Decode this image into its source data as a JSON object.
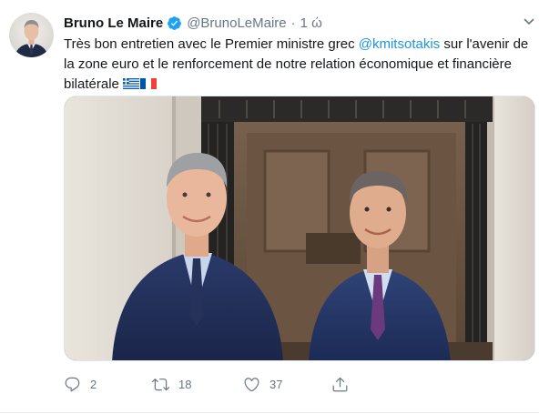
{
  "tweet": {
    "author": {
      "display_name": "Bruno Le Maire",
      "handle": "@BrunoLeMaire",
      "verified": true,
      "avatar_icon": "profile-photo"
    },
    "separator": "·",
    "time": "1 ώ",
    "text": {
      "before_mention": "Très bon entretien avec le Premier ministre grec ",
      "mention": "@kmitsotakis",
      "after_mention": " sur l'avenir de la zone euro et le renforcement de notre relation économique et financière bilatérale ",
      "flags": [
        "greece-flag",
        "france-flag"
      ]
    },
    "media": {
      "type": "photo",
      "icon": "photo"
    },
    "stats": {
      "replies": "2",
      "retweets": "18",
      "likes": "37"
    },
    "icons": {
      "verified": "verified-badge-icon",
      "caret": "chevron-down-icon",
      "reply": "reply-icon",
      "retweet": "retweet-icon",
      "like": "heart-icon",
      "share": "share-icon"
    },
    "colors": {
      "link": "#1b95e0",
      "verified": "#1da1f2",
      "muted": "#657786",
      "text": "#14171a"
    }
  }
}
